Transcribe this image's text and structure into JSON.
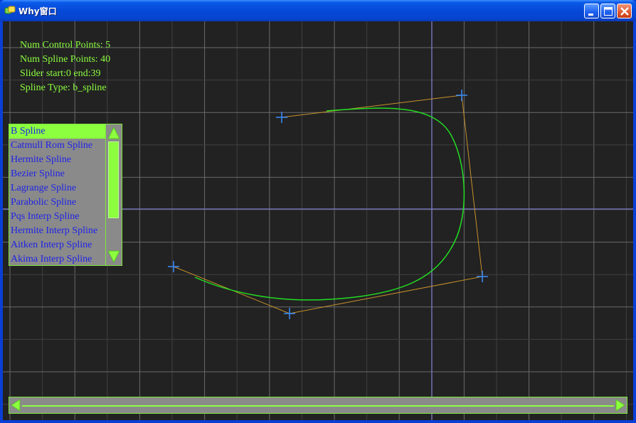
{
  "window": {
    "title": "Why窗口",
    "icons": {
      "app": "app-icon",
      "minimize": "minimize-icon",
      "maximize": "maximize-icon",
      "close": "close-icon"
    }
  },
  "info": {
    "num_control_points": "Num Control Points: 5",
    "num_spline_points": "Num Spline Points: 40",
    "slider": "Slider start:0 end:39",
    "spline_type": "Spline Type: b_spline"
  },
  "spline_list": {
    "items": [
      "B Spline",
      "Catmull Rom Spline",
      "Hermite Spline",
      "Bezier Spline",
      "Lagrange Spline",
      "Parabolic Spline",
      "Pqs Interp Spline",
      "Hermite Interp Spline",
      "Aitken Interp Spline",
      "Akima Interp Spline"
    ],
    "selected_index": 0
  },
  "slider": {
    "start": 0,
    "end": 39
  },
  "colors": {
    "background": "#222222",
    "grid": "#5e5e5e",
    "axis": "#8080d0",
    "text": "#8cff3f",
    "list_text": "#1f23e6",
    "curve": "#22dd22",
    "control_polygon": "#c8922a",
    "control_point": "#3a8cff"
  }
}
